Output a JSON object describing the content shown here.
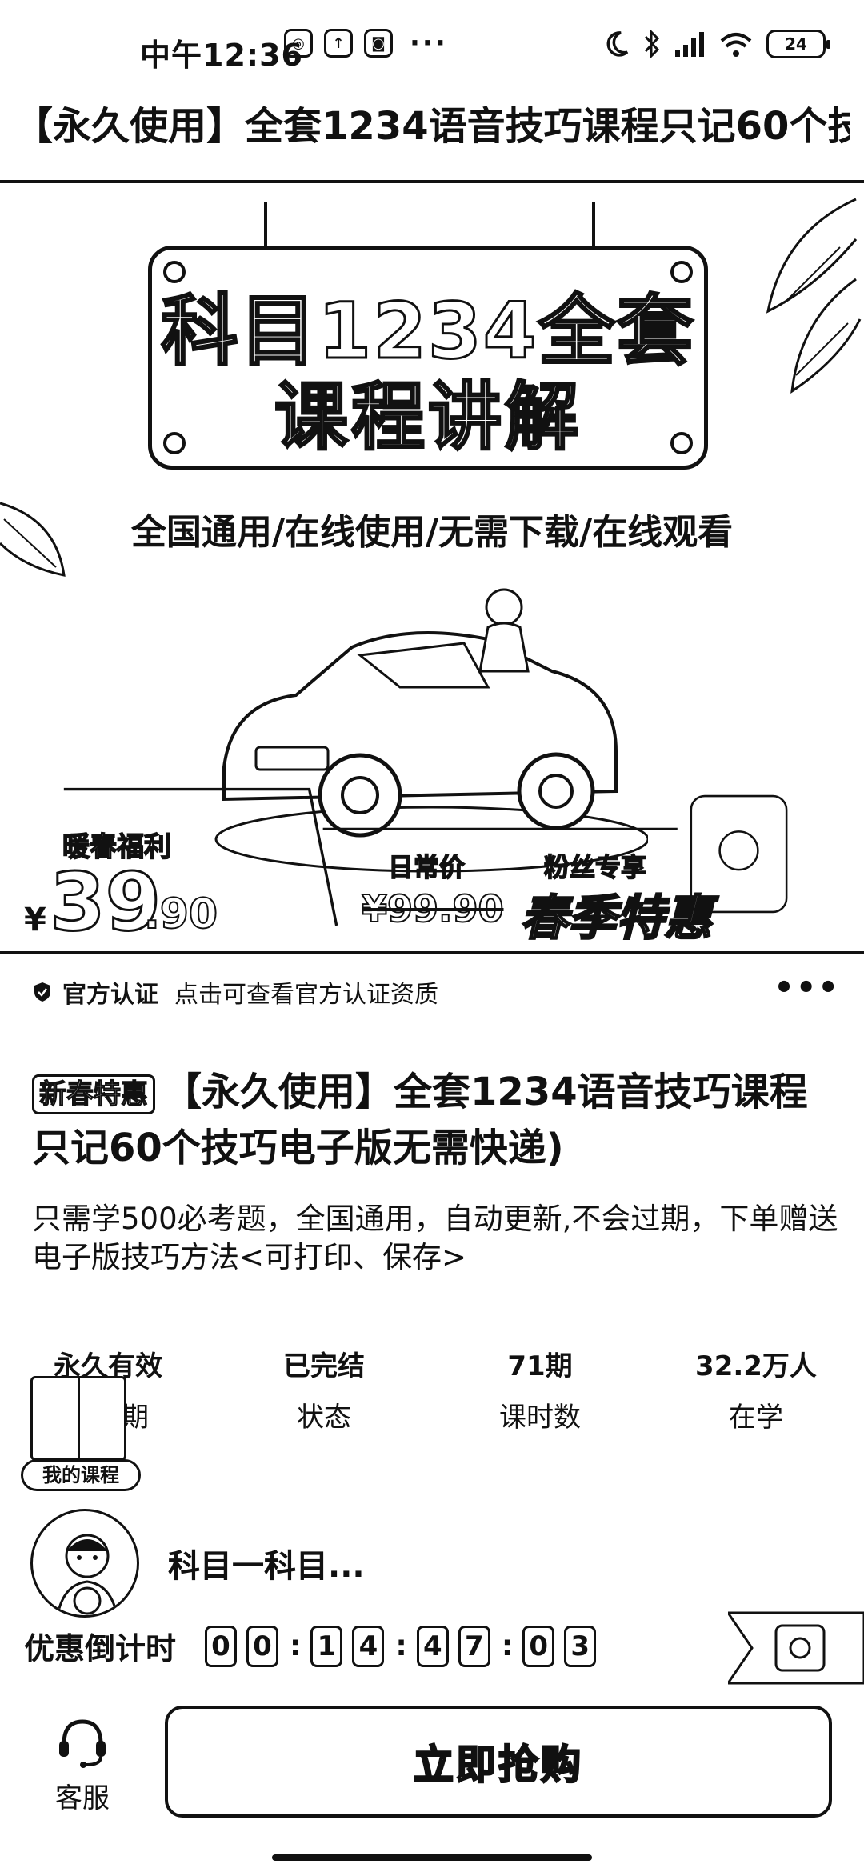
{
  "status_bar": {
    "time": "中午12:36",
    "left_icons": [
      "app-icon-1",
      "app-icon-2",
      "app-icon-3"
    ],
    "overflow": "···",
    "right_icons": [
      "moon-icon",
      "bluetooth-icon",
      "signal-icon",
      "wifi-icon"
    ],
    "battery": "24"
  },
  "page": {
    "title": "【永久使用】全套1234语音技巧课程只记60个技..."
  },
  "hero": {
    "sign_line1": "科目1234全套",
    "sign_line2": "课程讲解",
    "tagline": "全国通用/在线使用/无需下载/在线观看",
    "promo_label": "暖春福利",
    "yen": "¥",
    "price_main": "39",
    "price_decimal": ".90",
    "daily_label": "日常价",
    "daily_price": "¥99.90",
    "fans_label": "粉丝专享",
    "spring_deal": "春季特惠"
  },
  "cert": {
    "title": "官方认证",
    "desc": "点击可查看官方认证资质",
    "more": "•••"
  },
  "product": {
    "badge": "新春特惠",
    "title": "【永久使用】全套1234语音技巧课程只记60个技巧电子版无需快递)",
    "desc": "只需学500必考题，全国通用，自动更新,不会过期，下单赠送电子版技巧方法<可打印、保存>"
  },
  "stats": [
    {
      "value": "永久有效",
      "label": "有效期"
    },
    {
      "value": "已完结",
      "label": "状态"
    },
    {
      "value": "71期",
      "label": "课时数"
    },
    {
      "value": "32.2万人",
      "label": "在学"
    }
  ],
  "my_course": {
    "label": "我的课程"
  },
  "teacher": {
    "name": "科目一科目..."
  },
  "countdown": {
    "label": "优惠倒计时",
    "digits": [
      "0",
      "0",
      "1",
      "4",
      "4",
      "7",
      "0",
      "3"
    ]
  },
  "bottom": {
    "service_label": "客服",
    "buy_label": "立即抢购"
  }
}
